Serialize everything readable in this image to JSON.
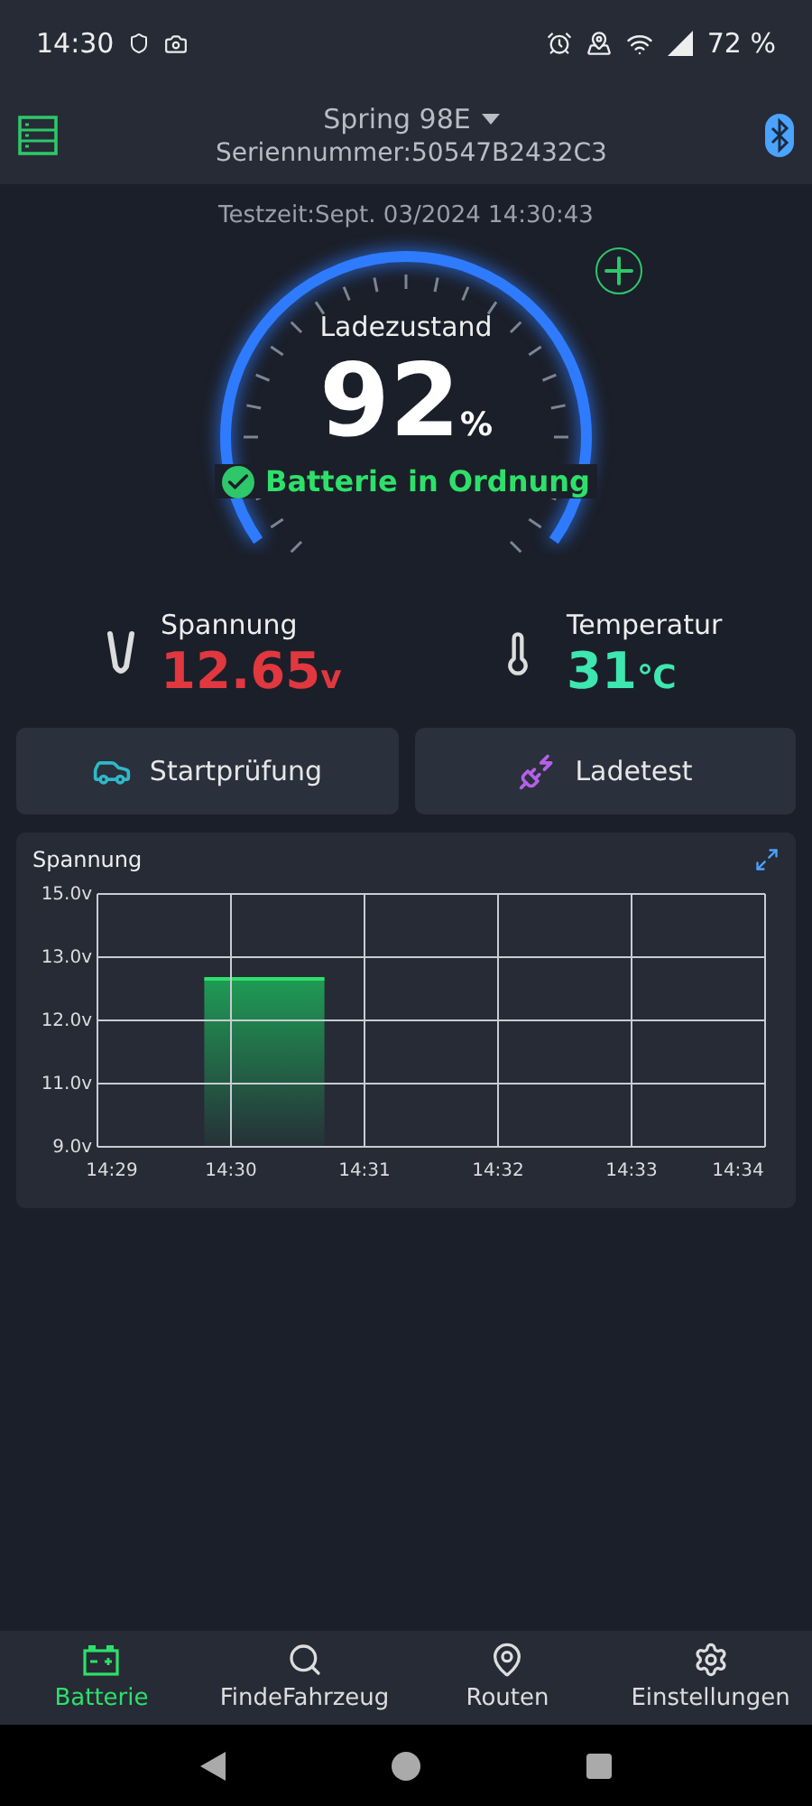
{
  "status_bar": {
    "time": "14:30",
    "battery": "72 %"
  },
  "header": {
    "device": "Spring 98E",
    "serial": "Seriennummer:50547B2432C3"
  },
  "test_time": "Testzeit:Sept. 03/2024 14:30:43",
  "gauge": {
    "label": "Ladezustand",
    "value": "92",
    "unit": "%",
    "status": "Batterie in Ordnung"
  },
  "readings": [
    {
      "kind": "voltage",
      "label": "Spannung",
      "value": "12.65",
      "unit": "v",
      "color": "#e0383e"
    },
    {
      "kind": "temperature",
      "label": "Temperatur",
      "value": "31",
      "unit": "℃",
      "color": "#3ee6b0"
    }
  ],
  "actions": [
    {
      "kind": "car",
      "label": "Startprüfung"
    },
    {
      "kind": "plug",
      "label": "Ladetest"
    }
  ],
  "chart": {
    "title": "Spannung",
    "y_labels": [
      "15.0v",
      "13.0v",
      "12.0v",
      "11.0v",
      "9.0v"
    ],
    "x_labels": [
      "14:29",
      "14:30",
      "14:31",
      "14:32",
      "14:33",
      "14:34"
    ]
  },
  "tabs": [
    {
      "kind": "battery",
      "label": "Batterie",
      "selected": true
    },
    {
      "kind": "search",
      "label": "FindeFahrzeug",
      "selected": false
    },
    {
      "kind": "route",
      "label": "Routen",
      "selected": false
    },
    {
      "kind": "settings",
      "label": "Einstellungen",
      "selected": false
    }
  ]
}
